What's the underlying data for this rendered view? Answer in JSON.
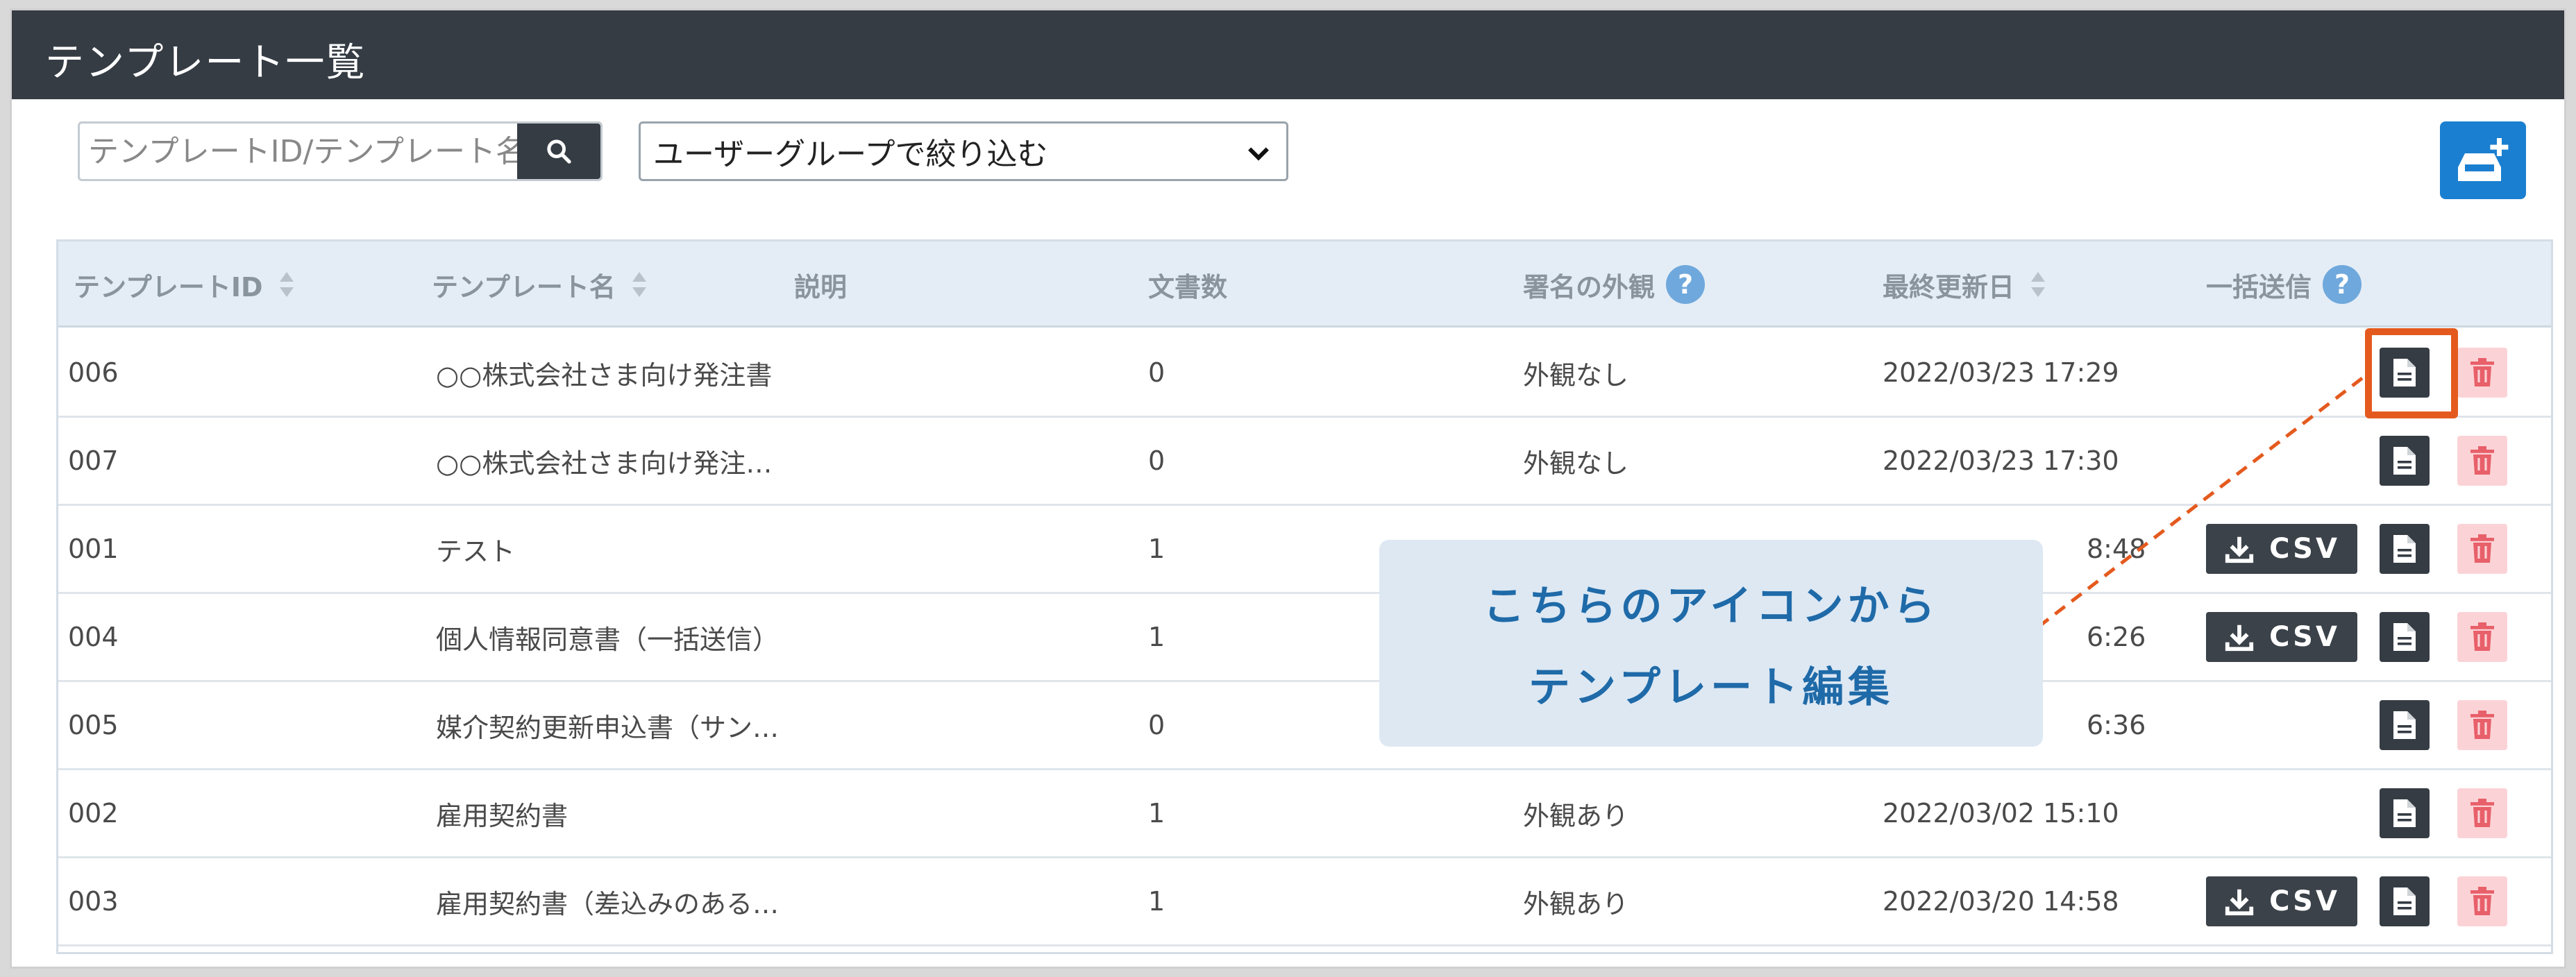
{
  "header": {
    "title": "テンプレート一覧"
  },
  "toolbar": {
    "search_placeholder": "テンプレートID/テンプレート名",
    "group_filter": "ユーザーグループで絞り込む"
  },
  "table": {
    "columns": {
      "id": "テンプレートID",
      "name": "テンプレート名",
      "description": "説明",
      "doc_count": "文書数",
      "signature": "署名の外観",
      "updated": "最終更新日",
      "bulk_send": "一括送信"
    },
    "help_glyph": "?",
    "csv_label": "CSV",
    "rows": [
      {
        "id": "006",
        "name": "○○株式会社さま向け発注書",
        "docs": "0",
        "sig": "外観なし",
        "date": "2022/03/23 17:29",
        "csv": false
      },
      {
        "id": "007",
        "name": "○○株式会社さま向け発注…",
        "docs": "0",
        "sig": "外観なし",
        "date": "2022/03/23 17:30",
        "csv": false
      },
      {
        "id": "001",
        "name": "テスト",
        "docs": "1",
        "sig": "",
        "date": "8:48",
        "csv": true
      },
      {
        "id": "004",
        "name": "個人情報同意書（一括送信）",
        "docs": "1",
        "sig": "",
        "date": "6:26",
        "csv": true
      },
      {
        "id": "005",
        "name": "媒介契約更新申込書（サン…",
        "docs": "0",
        "sig": "",
        "date": "6:36",
        "csv": false
      },
      {
        "id": "002",
        "name": "雇用契約書",
        "docs": "1",
        "sig": "外観あり",
        "date": "2022/03/02 15:10",
        "csv": false
      },
      {
        "id": "003",
        "name": "雇用契約書（差込みのある…",
        "docs": "1",
        "sig": "外観あり",
        "date": "2022/03/20 14:58",
        "csv": true
      }
    ]
  },
  "callout": {
    "line1": "こちらのアイコンから",
    "line2": "テンプレート編集"
  },
  "colors": {
    "accent": "#1a7fd0",
    "highlight": "#e45a1e",
    "dark": "#353c44",
    "danger": "#e8606a"
  }
}
